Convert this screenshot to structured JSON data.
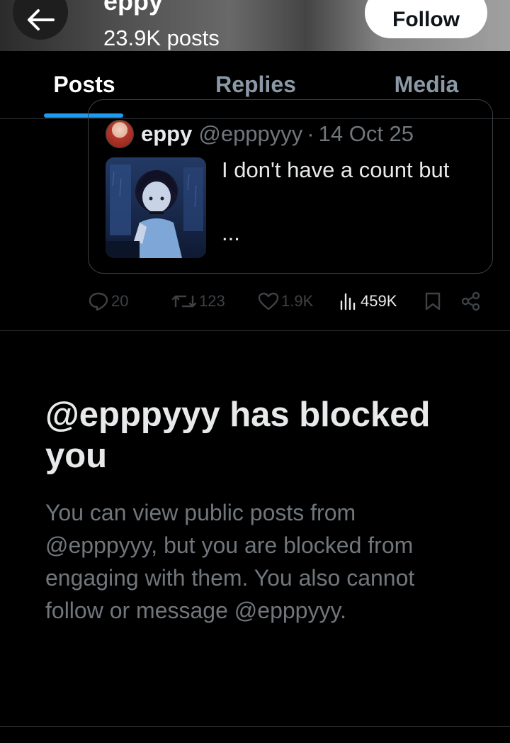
{
  "header": {
    "profile_name": "eppy",
    "post_count": "23.9K posts",
    "follow_label": "Follow"
  },
  "tabs": [
    {
      "label": "Posts",
      "active": true
    },
    {
      "label": "Replies",
      "active": false
    },
    {
      "label": "Media",
      "active": false
    }
  ],
  "quote": {
    "author": "eppy",
    "handle": "@epppyyy",
    "separator": "·",
    "date": "14 Oct 25",
    "text": "I don't have a count but",
    "ellipsis": "..."
  },
  "actions": {
    "replies": "20",
    "reposts": "123",
    "likes": "1.9K",
    "views": "459K"
  },
  "blocked": {
    "title": "@epppyyy has blocked you",
    "body": "You can view public posts from @epppyyy, but you are blocked from engaging with them. You also cannot follow or message @epppyyy."
  },
  "colors": {
    "background": "#000000",
    "accent": "#1d9bf0",
    "muted_text": "#71767b",
    "primary_text": "#e7e9ea",
    "divider": "#2f3336"
  },
  "icons": [
    "arrow-left-icon",
    "reply-icon",
    "repost-icon",
    "like-icon",
    "views-icon",
    "bookmark-icon",
    "share-icon"
  ]
}
